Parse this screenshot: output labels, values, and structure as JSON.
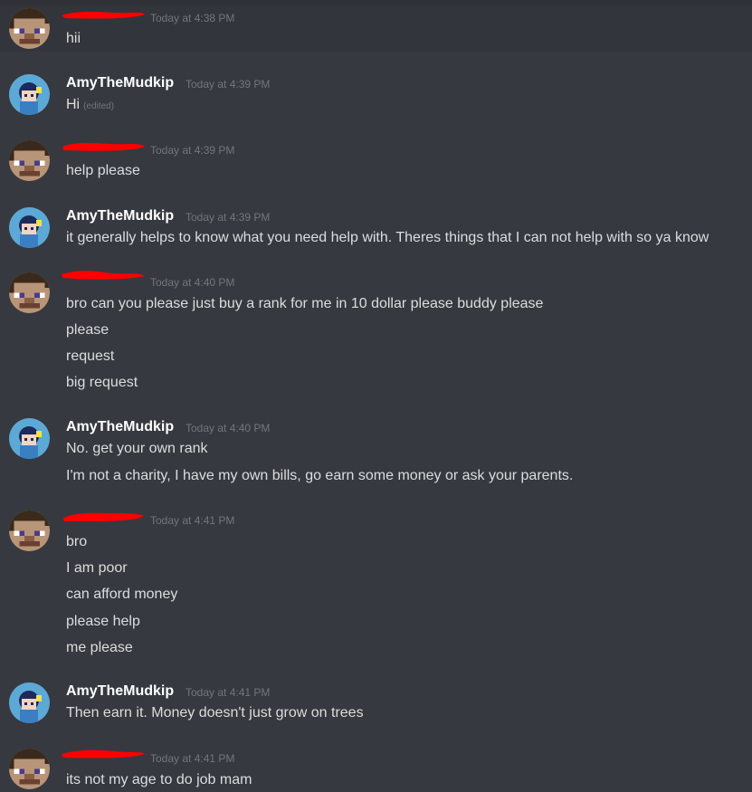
{
  "colors": {
    "background": "#36393f",
    "username": "#ffffff",
    "timestamp": "#72767d",
    "text": "#dcddde",
    "redaction": "#ff0000"
  },
  "messages": [
    {
      "author": "",
      "author_redacted": true,
      "avatar": "steve-avatar",
      "time": "Today at 4:38 PM",
      "lines": [
        "hii"
      ]
    },
    {
      "author": "AmyTheMudkip",
      "author_redacted": false,
      "avatar": "amy-avatar",
      "time": "Today at 4:39 PM",
      "lines": [
        "Hi"
      ],
      "edited": "(edited)"
    },
    {
      "author": "",
      "author_redacted": true,
      "avatar": "steve-avatar",
      "time": "Today at 4:39 PM",
      "lines": [
        "help please"
      ]
    },
    {
      "author": "AmyTheMudkip",
      "author_redacted": false,
      "avatar": "amy-avatar",
      "time": "Today at 4:39 PM",
      "lines": [
        "it generally helps to know what you need help with. Theres things that I can not help with so ya know"
      ]
    },
    {
      "author": "",
      "author_redacted": true,
      "avatar": "steve-avatar",
      "time": "Today at 4:40 PM",
      "lines": [
        "bro can you please just buy a rank for me in 10 dollar please buddy please",
        "please",
        "request",
        "big request"
      ]
    },
    {
      "author": "AmyTheMudkip",
      "author_redacted": false,
      "avatar": "amy-avatar",
      "time": "Today at 4:40 PM",
      "lines": [
        "No. get your own rank",
        "I'm not a charity, I have my own bills, go earn some money or ask your parents."
      ]
    },
    {
      "author": "",
      "author_redacted": true,
      "avatar": "steve-avatar",
      "time": "Today at 4:41 PM",
      "lines": [
        "bro",
        "I am poor",
        "can afford money",
        "please help",
        "me please"
      ]
    },
    {
      "author": "AmyTheMudkip",
      "author_redacted": false,
      "avatar": "amy-avatar",
      "time": "Today at 4:41 PM",
      "lines": [
        "Then earn it. Money doesn't just grow on trees"
      ]
    },
    {
      "author": "",
      "author_redacted": true,
      "avatar": "steve-avatar",
      "time": "Today at 4:41 PM",
      "lines": [
        "its not my age to do job mam"
      ]
    }
  ]
}
